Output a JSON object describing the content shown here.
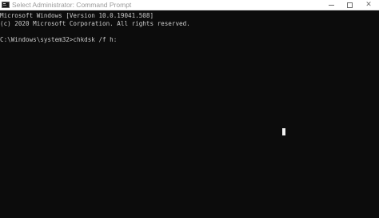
{
  "window": {
    "title": "Select Administrator: Command Prompt",
    "icon": "command-prompt-icon",
    "controls": {
      "minimize_icon": "minimize-icon",
      "maximize_icon": "maximize-icon",
      "close_glyph": "✕"
    }
  },
  "console": {
    "lines": [
      "Microsoft Windows [Version 10.0.19041.508]",
      "(c) 2020 Microsoft Corporation. All rights reserved.",
      "C:\\Windows\\system32>chkdsk /f h:"
    ],
    "colors": {
      "background": "#0c0c0c",
      "text": "#cccccc",
      "cursor": "#f2f2f2"
    }
  }
}
